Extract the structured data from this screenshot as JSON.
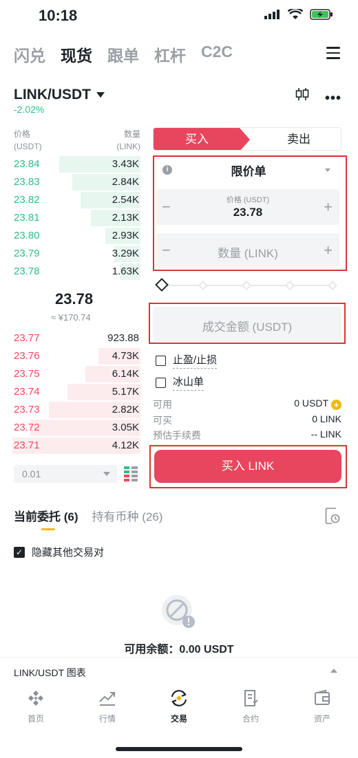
{
  "status": {
    "time": "10:18"
  },
  "top_nav": [
    "闪兑",
    "现货",
    "跟单",
    "杠杆",
    "C2C"
  ],
  "pair": {
    "name": "LINK/USDT",
    "change": "-2.02%"
  },
  "orderbook": {
    "price_header": "价格",
    "price_unit": "(USDT)",
    "qty_header": "数量",
    "qty_unit": "(LINK)",
    "asks": [
      {
        "price": "23.84",
        "qty": "3.43K",
        "depth": 0.62
      },
      {
        "price": "23.83",
        "qty": "2.84K",
        "depth": 0.52
      },
      {
        "price": "23.82",
        "qty": "2.54K",
        "depth": 0.46
      },
      {
        "price": "23.81",
        "qty": "2.13K",
        "depth": 0.38
      },
      {
        "price": "23.80",
        "qty": "2.93K",
        "depth": 0.27
      },
      {
        "price": "23.79",
        "qty": "3.29K",
        "depth": 0.2
      },
      {
        "price": "23.78",
        "qty": "1.63K",
        "depth": 0.16
      }
    ],
    "mid_price": "23.78",
    "mid_fiat": "≈ ¥170.74",
    "bids": [
      {
        "price": "23.77",
        "qty": "923.88",
        "depth": 0.0
      },
      {
        "price": "23.76",
        "qty": "4.73K",
        "depth": 0.32
      },
      {
        "price": "23.75",
        "qty": "6.14K",
        "depth": 0.42
      },
      {
        "price": "23.74",
        "qty": "5.17K",
        "depth": 0.56
      },
      {
        "price": "23.73",
        "qty": "2.82K",
        "depth": 0.7
      },
      {
        "price": "23.72",
        "qty": "3.05K",
        "depth": 0.84
      },
      {
        "price": "23.71",
        "qty": "4.12K",
        "depth": 0.98
      }
    ],
    "depth_select": "0.01"
  },
  "order_form": {
    "buy_tab": "买入",
    "sell_tab": "卖出",
    "order_type": "限价单",
    "info_glyph": "i",
    "price_label": "价格 (USDT)",
    "price_value": "23.78",
    "qty_placeholder": "数量 (LINK)",
    "total_placeholder": "成交金额 (USDT)",
    "tp_sl": "止盈/止损",
    "iceberg": "冰山单",
    "available_label": "可用",
    "available_value": "0 USDT",
    "can_buy_label": "可买",
    "can_buy_value": "0 LINK",
    "fee_label": "预估手续费",
    "fee_value": "-- LINK",
    "buy_button": "买入 LINK",
    "minus": "−",
    "plus": "+"
  },
  "orders": {
    "tab_open": "当前委托 (6)",
    "tab_holdings": "持有币种 (26)",
    "hide_pairs": "隐藏其他交易对",
    "balance": "可用余额：0.00 USDT"
  },
  "chart_bar": {
    "label": "LINK/USDT 图表"
  },
  "bottom_nav": [
    "首页",
    "行情",
    "交易",
    "合约",
    "资产"
  ],
  "colors": {
    "buy": "#e8465e",
    "ask": "#2ebd85",
    "bid": "#f6465d",
    "accent": "#f0b90b",
    "highlight_box": "#d93434"
  }
}
